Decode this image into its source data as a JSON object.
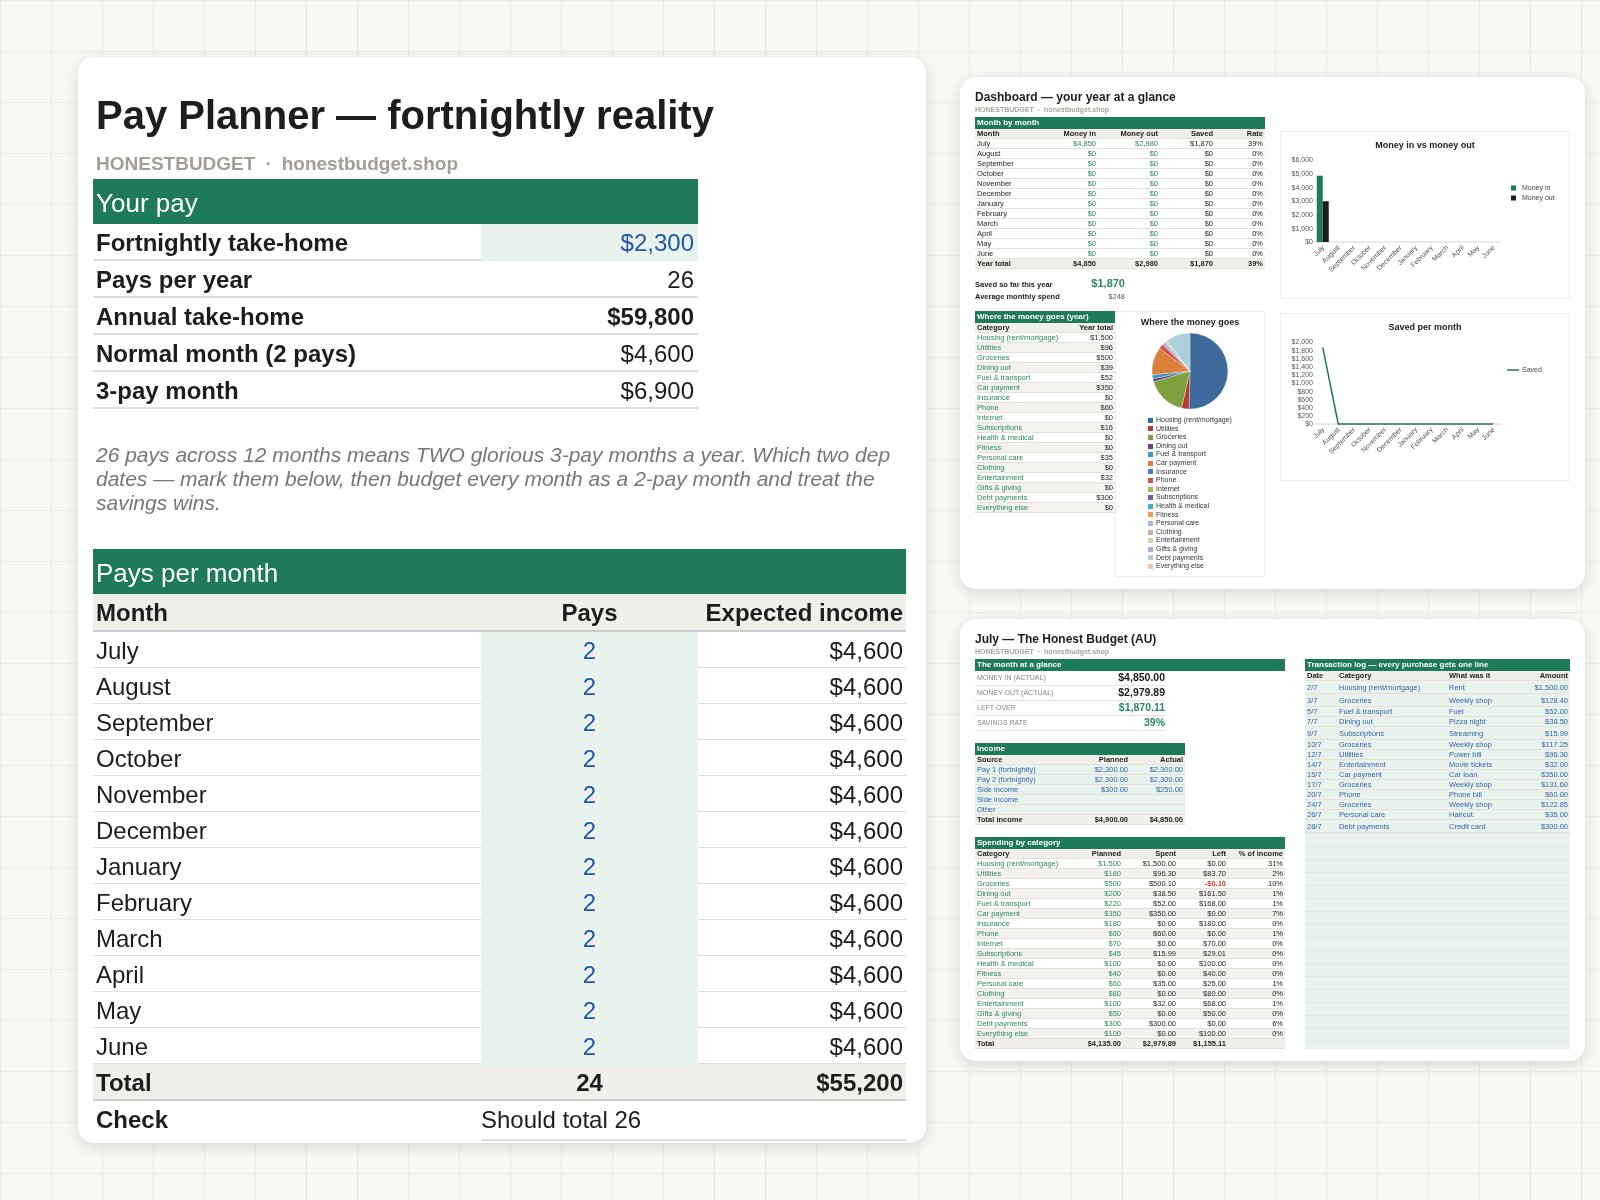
{
  "planner": {
    "title": "Pay Planner — fortnightly reality",
    "brand": {
      "name": "HONESTBUDGET",
      "separator": "·",
      "site": "honestbudget.shop"
    },
    "your_pay": {
      "heading": "Your pay",
      "rows": [
        {
          "label": "Fortnightly take-home",
          "value": "$2,300",
          "kind": "input"
        },
        {
          "label": "Pays per year",
          "value": "26",
          "kind": "plain"
        },
        {
          "label": "Annual take-home",
          "value": "$59,800",
          "kind": "bold"
        },
        {
          "label": "Normal month (2 pays)",
          "value": "$4,600",
          "kind": "plain"
        },
        {
          "label": "3-pay month",
          "value": "$6,900",
          "kind": "plain"
        }
      ]
    },
    "note": "26 pays across 12 months means TWO glorious 3-pay months a year. Which two dep\ndates — mark them below, then budget every month as a 2-pay month and treat the\nsavings wins.",
    "pays_per_month": {
      "heading": "Pays per month",
      "columns": [
        "Month",
        "Pays",
        "Expected income"
      ],
      "rows": [
        {
          "month": "July",
          "pays": "2",
          "income": "$4,600"
        },
        {
          "month": "August",
          "pays": "2",
          "income": "$4,600"
        },
        {
          "month": "September",
          "pays": "2",
          "income": "$4,600"
        },
        {
          "month": "October",
          "pays": "2",
          "income": "$4,600"
        },
        {
          "month": "November",
          "pays": "2",
          "income": "$4,600"
        },
        {
          "month": "December",
          "pays": "2",
          "income": "$4,600"
        },
        {
          "month": "January",
          "pays": "2",
          "income": "$4,600"
        },
        {
          "month": "February",
          "pays": "2",
          "income": "$4,600"
        },
        {
          "month": "March",
          "pays": "2",
          "income": "$4,600"
        },
        {
          "month": "April",
          "pays": "2",
          "income": "$4,600"
        },
        {
          "month": "May",
          "pays": "2",
          "income": "$4,600"
        },
        {
          "month": "June",
          "pays": "2",
          "income": "$4,600"
        }
      ],
      "total": {
        "month": "Total",
        "pays": "24",
        "income": "$55,200"
      },
      "check": {
        "label": "Check",
        "value": "Should total 26"
      }
    }
  },
  "dashboard": {
    "title": "Dashboard — your year at a glance",
    "brand": {
      "name": "HONESTBUDGET",
      "separator": "·",
      "site": "honestbudget.shop"
    },
    "month_by_month": {
      "heading": "Month by month",
      "columns": [
        "Month",
        "Money in",
        "Money out",
        "Saved",
        "Rate"
      ],
      "rows": [
        {
          "month": "July",
          "in": "$4,850",
          "out": "$2,980",
          "saved": "$1,870",
          "rate": "39%"
        },
        {
          "month": "August",
          "in": "$0",
          "out": "$0",
          "saved": "$0",
          "rate": "0%"
        },
        {
          "month": "September",
          "in": "$0",
          "out": "$0",
          "saved": "$0",
          "rate": "0%"
        },
        {
          "month": "October",
          "in": "$0",
          "out": "$0",
          "saved": "$0",
          "rate": "0%"
        },
        {
          "month": "November",
          "in": "$0",
          "out": "$0",
          "saved": "$0",
          "rate": "0%"
        },
        {
          "month": "December",
          "in": "$0",
          "out": "$0",
          "saved": "$0",
          "rate": "0%"
        },
        {
          "month": "January",
          "in": "$0",
          "out": "$0",
          "saved": "$0",
          "rate": "0%"
        },
        {
          "month": "February",
          "in": "$0",
          "out": "$0",
          "saved": "$0",
          "rate": "0%"
        },
        {
          "month": "March",
          "in": "$0",
          "out": "$0",
          "saved": "$0",
          "rate": "0%"
        },
        {
          "month": "April",
          "in": "$0",
          "out": "$0",
          "saved": "$0",
          "rate": "0%"
        },
        {
          "month": "May",
          "in": "$0",
          "out": "$0",
          "saved": "$0",
          "rate": "0%"
        },
        {
          "month": "June",
          "in": "$0",
          "out": "$0",
          "saved": "$0",
          "rate": "0%"
        }
      ],
      "total": {
        "month": "Year total",
        "in": "$4,850",
        "out": "$2,980",
        "saved": "$1,870",
        "rate": "39%"
      }
    },
    "summary": [
      {
        "label": "Saved so far this year",
        "value": "$1,870",
        "kind": "highlight"
      },
      {
        "label": "Average monthly spend",
        "value": "$248",
        "kind": "plain"
      }
    ],
    "money_goes": {
      "heading": "Where the money goes (year)",
      "columns": [
        "Category",
        "Year total"
      ],
      "rows": [
        {
          "category": "Housing (rent/mortgage)",
          "total": "$1,500"
        },
        {
          "category": "Utilities",
          "total": "$96"
        },
        {
          "category": "Groceries",
          "total": "$500"
        },
        {
          "category": "Dining out",
          "total": "$39"
        },
        {
          "category": "Fuel & transport",
          "total": "$52"
        },
        {
          "category": "Car payment",
          "total": "$350"
        },
        {
          "category": "Insurance",
          "total": "$0"
        },
        {
          "category": "Phone",
          "total": "$60"
        },
        {
          "category": "Internet",
          "total": "$0"
        },
        {
          "category": "Subscriptions",
          "total": "$16"
        },
        {
          "category": "Health & medical",
          "total": "$0"
        },
        {
          "category": "Fitness",
          "total": "$0"
        },
        {
          "category": "Personal care",
          "total": "$35"
        },
        {
          "category": "Clothing",
          "total": "$0"
        },
        {
          "category": "Entertainment",
          "total": "$32"
        },
        {
          "category": "Gifts & giving",
          "total": "$0"
        },
        {
          "category": "Debt payments",
          "total": "$300"
        },
        {
          "category": "Everything else",
          "total": "$0"
        }
      ]
    },
    "pie_chart": {
      "chart_data": {
        "type": "pie",
        "title": "Where the money goes",
        "categories": [
          "Housing (rent/mortgage)",
          "Utilities",
          "Groceries",
          "Dining out",
          "Fuel & transport",
          "Car payment",
          "Insurance",
          "Phone",
          "Internet",
          "Subscriptions",
          "Health & medical",
          "Fitness",
          "Personal care",
          "Clothing",
          "Entertainment",
          "Gifts & giving",
          "Debt payments",
          "Everything else"
        ],
        "values": [
          50.4,
          3.2,
          16.8,
          1.3,
          1.7,
          11.7,
          0,
          2.0,
          0,
          0.5,
          0,
          0,
          1.2,
          0,
          1.1,
          0,
          10.1,
          0
        ],
        "legend": "bottom",
        "colors": [
          "#3f6a9c",
          "#b23b33",
          "#7fa03f",
          "#6b3f8e",
          "#3b9bb0",
          "#d9813b",
          "#4f7dc2",
          "#d2504a",
          "#9dbf5e",
          "#7d5ba6",
          "#42b1c9",
          "#f39a4b",
          "#a9b7de",
          "#dba3a2",
          "#c4dca3",
          "#b9a8d6",
          "#a9cfdb",
          "#f7c7a2"
        ]
      }
    },
    "bar_chart": {
      "chart_data": {
        "type": "bar",
        "title": "Money in vs money out",
        "categories": [
          "July",
          "August",
          "September",
          "October",
          "November",
          "December",
          "January",
          "February",
          "March",
          "April",
          "May",
          "June"
        ],
        "series": [
          {
            "name": "Money in",
            "color": "#1f7a5a",
            "values": [
              4850,
              0,
              0,
              0,
              0,
              0,
              0,
              0,
              0,
              0,
              0,
              0
            ]
          },
          {
            "name": "Money out",
            "color": "#1c1c1c",
            "values": [
              2980,
              0,
              0,
              0,
              0,
              0,
              0,
              0,
              0,
              0,
              0,
              0
            ]
          }
        ],
        "ylim": [
          0,
          6000
        ],
        "legend": "right",
        "yticks": [
          {
            "value": 0,
            "label": "$0"
          },
          {
            "value": 1000,
            "label": "$1,000"
          },
          {
            "value": 2000,
            "label": "$2,000"
          },
          {
            "value": 3000,
            "label": "$3,000"
          },
          {
            "value": 4000,
            "label": "$4,000"
          },
          {
            "value": 5000,
            "label": "$5,000"
          },
          {
            "value": 6000,
            "label": "$6,000"
          }
        ]
      }
    },
    "line_chart": {
      "chart_data": {
        "type": "line",
        "title": "Saved per month",
        "categories": [
          "July",
          "August",
          "September",
          "October",
          "November",
          "December",
          "January",
          "February",
          "March",
          "April",
          "May",
          "June"
        ],
        "series": [
          {
            "name": "Saved",
            "color": "#1f7a5a",
            "values": [
              1870,
              0,
              0,
              0,
              0,
              0,
              0,
              0,
              0,
              0,
              0,
              0
            ]
          }
        ],
        "ylim": [
          0,
          2000
        ],
        "legend": "right",
        "yticks": [
          {
            "value": 0,
            "label": "$0"
          },
          {
            "value": 200,
            "label": "$200"
          },
          {
            "value": 400,
            "label": "$400"
          },
          {
            "value": 600,
            "label": "$600"
          },
          {
            "value": 800,
            "label": "$800"
          },
          {
            "value": 1000,
            "label": "$1,000"
          },
          {
            "value": 1200,
            "label": "$1,200"
          },
          {
            "value": 1400,
            "label": "$1,400"
          },
          {
            "value": 1600,
            "label": "$1,600"
          },
          {
            "value": 1800,
            "label": "$1,800"
          },
          {
            "value": 2000,
            "label": "$2,000"
          }
        ]
      }
    }
  },
  "july": {
    "title": "July — The Honest Budget (AU)",
    "brand": {
      "name": "HONESTBUDGET",
      "separator": "·",
      "site": "honestbudget.shop"
    },
    "glance": {
      "heading": "The month at a glance",
      "rows": [
        {
          "label": "MONEY IN (ACTUAL)",
          "value": "$4,850.00",
          "kind": "plain"
        },
        {
          "label": "MONEY OUT (ACTUAL)",
          "value": "$2,979.89",
          "kind": "plain"
        },
        {
          "label": "LEFT OVER",
          "value": "$1,870.11",
          "kind": "highlight"
        },
        {
          "label": "SAVINGS RATE",
          "value": "39%",
          "kind": "highlight"
        }
      ]
    },
    "income": {
      "heading": "Income",
      "columns": [
        "Source",
        "Planned",
        "Actual"
      ],
      "rows": [
        {
          "source": "Pay 1 (fortnightly)",
          "planned": "$2,300.00",
          "actual": "$2,300.00"
        },
        {
          "source": "Pay 2 (fortnightly)",
          "planned": "$2,300.00",
          "actual": "$2,300.00"
        },
        {
          "source": "Side income",
          "planned": "$300.00",
          "actual": "$250.00"
        },
        {
          "source": "Side income"
        },
        {
          "source": "Other"
        }
      ],
      "total": {
        "source": "Total income",
        "planned": "$4,900.00",
        "actual": "$4,850.00"
      }
    },
    "spending": {
      "heading": "Spending by category",
      "columns": [
        "Category",
        "Planned",
        "Spent",
        "Left",
        "% of income"
      ],
      "rows": [
        {
          "category": "Housing (rent/mortgage)",
          "planned": "$1,500",
          "spent": "$1,500.00",
          "left": "$0.00",
          "pct": "31%",
          "over": false
        },
        {
          "category": "Utilities",
          "planned": "$180",
          "spent": "$96.30",
          "left": "$83.70",
          "pct": "2%",
          "over": false
        },
        {
          "category": "Groceries",
          "planned": "$500",
          "spent": "$500.10",
          "left": "-$0.10",
          "pct": "10%",
          "over": true
        },
        {
          "category": "Dining out",
          "planned": "$200",
          "spent": "$38.50",
          "left": "$161.50",
          "pct": "1%",
          "over": false
        },
        {
          "category": "Fuel & transport",
          "planned": "$220",
          "spent": "$52.00",
          "left": "$168.00",
          "pct": "1%",
          "over": false
        },
        {
          "category": "Car payment",
          "planned": "$350",
          "spent": "$350.00",
          "left": "$0.00",
          "pct": "7%",
          "over": false
        },
        {
          "category": "Insurance",
          "planned": "$180",
          "spent": "$0.00",
          "left": "$180.00",
          "pct": "0%",
          "over": false
        },
        {
          "category": "Phone",
          "planned": "$60",
          "spent": "$60.00",
          "left": "$0.00",
          "pct": "1%",
          "over": false
        },
        {
          "category": "Internet",
          "planned": "$70",
          "spent": "$0.00",
          "left": "$70.00",
          "pct": "0%",
          "over": false
        },
        {
          "category": "Subscriptions",
          "planned": "$45",
          "spent": "$15.99",
          "left": "$29.01",
          "pct": "0%",
          "over": false
        },
        {
          "category": "Health & medical",
          "planned": "$100",
          "spent": "$0.00",
          "left": "$100.00",
          "pct": "0%",
          "over": false
        },
        {
          "category": "Fitness",
          "planned": "$40",
          "spent": "$0.00",
          "left": "$40.00",
          "pct": "0%",
          "over": false
        },
        {
          "category": "Personal care",
          "planned": "$60",
          "spent": "$35.00",
          "left": "$25.00",
          "pct": "1%",
          "over": false
        },
        {
          "category": "Clothing",
          "planned": "$80",
          "spent": "$0.00",
          "left": "$80.00",
          "pct": "0%",
          "over": false
        },
        {
          "category": "Entertainment",
          "planned": "$100",
          "spent": "$32.00",
          "left": "$68.00",
          "pct": "1%",
          "over": false
        },
        {
          "category": "Gifts & giving",
          "planned": "$50",
          "spent": "$0.00",
          "left": "$50.00",
          "pct": "0%",
          "over": false
        },
        {
          "category": "Debt payments",
          "planned": "$300",
          "spent": "$300.00",
          "left": "$0.00",
          "pct": "6%",
          "over": false
        },
        {
          "category": "Everything else",
          "planned": "$100",
          "spent": "$0.00",
          "left": "$100.00",
          "pct": "0%",
          "over": false
        }
      ],
      "total": {
        "category": "Total",
        "planned": "$4,135.00",
        "spent": "$2,979.89",
        "left": "$1,155.11"
      }
    },
    "transactions": {
      "heading": "Transaction log — every purchase gets one line",
      "columns": [
        "Date",
        "Category",
        "What was it",
        "Amount"
      ],
      "rows": [
        {
          "date": "2/7",
          "category": "Housing (rent/mortgage)",
          "what": "Rent",
          "amount": "$1,500.00"
        },
        {
          "date": "3/7",
          "category": "Groceries",
          "what": "Weekly shop",
          "amount": "$128.40"
        },
        {
          "date": "5/7",
          "category": "Fuel & transport",
          "what": "Fuel",
          "amount": "$52.00"
        },
        {
          "date": "7/7",
          "category": "Dining out",
          "what": "Pizza night",
          "amount": "$38.50"
        },
        {
          "date": "9/7",
          "category": "Subscriptions",
          "what": "Streaming",
          "amount": "$15.99"
        },
        {
          "date": "10/7",
          "category": "Groceries",
          "what": "Weekly shop",
          "amount": "$117.25"
        },
        {
          "date": "12/7",
          "category": "Utilities",
          "what": "Power bill",
          "amount": "$96.30"
        },
        {
          "date": "14/7",
          "category": "Entertainment",
          "what": "Movie tickets",
          "amount": "$32.00"
        },
        {
          "date": "15/7",
          "category": "Car payment",
          "what": "Car loan",
          "amount": "$350.00"
        },
        {
          "date": "17/7",
          "category": "Groceries",
          "what": "Weekly shop",
          "amount": "$131.60"
        },
        {
          "date": "20/7",
          "category": "Phone",
          "what": "Phone bill",
          "amount": "$60.00"
        },
        {
          "date": "24/7",
          "category": "Groceries",
          "what": "Weekly shop",
          "amount": "$122.85"
        },
        {
          "date": "26/7",
          "category": "Personal care",
          "what": "Haircut",
          "amount": "$35.00"
        },
        {
          "date": "28/7",
          "category": "Debt payments",
          "what": "Credit card",
          "amount": "$300.00"
        }
      ]
    }
  }
}
